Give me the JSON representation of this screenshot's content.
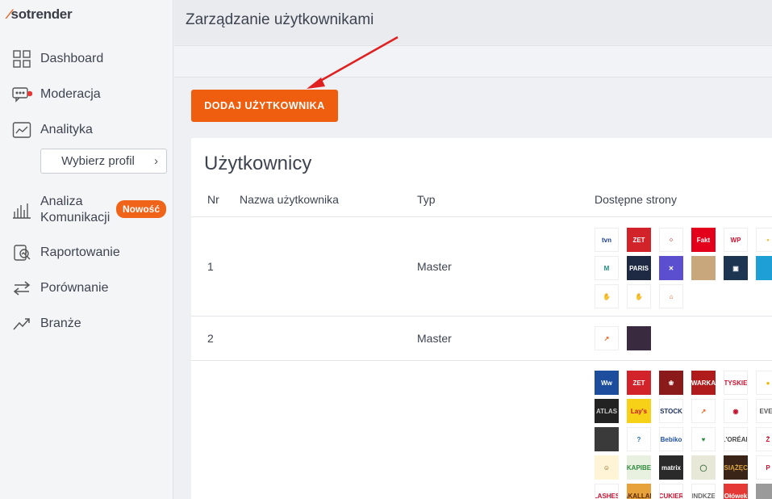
{
  "app": {
    "logo": "sotrender"
  },
  "sidebar": {
    "items": [
      {
        "label": "Dashboard",
        "icon": "dashboard-icon"
      },
      {
        "label": "Moderacja",
        "icon": "chat-icon"
      },
      {
        "label": "Analityka",
        "icon": "analytics-icon"
      },
      {
        "label": "Analiza Komunikacji",
        "icon": "bar-chart-icon"
      },
      {
        "label": "Raportowanie",
        "icon": "report-icon"
      },
      {
        "label": "Porównanie",
        "icon": "compare-icon"
      },
      {
        "label": "Branże",
        "icon": "trend-icon"
      }
    ],
    "profile_select": "Wybierz profil",
    "analysis_line1": "Analiza",
    "analysis_line2": "Komunikacji",
    "badge_new": "Nowość",
    "moderation_dot_color": "#e53935"
  },
  "header": {
    "title": "Zarządzanie użytkownikami"
  },
  "actions": {
    "add_user": "DODAJ UŻYTKOWNIKA"
  },
  "users": {
    "title": "Użytkownicy",
    "columns": [
      "Nr",
      "Nazwa użytkownika",
      "Typ",
      "Dostępne strony"
    ],
    "rows": [
      {
        "nr": "1",
        "name": "",
        "type": "Master",
        "pages_count": 15
      },
      {
        "nr": "2",
        "name": "",
        "type": "Master",
        "pages_count": 2
      },
      {
        "nr": "",
        "name": "",
        "type": "",
        "pages_count": 35
      }
    ]
  },
  "page_thumbs": {
    "row1": [
      {
        "label": "tvn",
        "bg": "#ffffff",
        "fg": "#1a3d8f"
      },
      {
        "label": "ZET",
        "bg": "#d2232a",
        "fg": "#ffffff"
      },
      {
        "label": "⁘",
        "bg": "#ffffff",
        "fg": "#e53935"
      },
      {
        "label": "Fakt",
        "bg": "#e3001b",
        "fg": "#ffffff"
      },
      {
        "label": "WP",
        "bg": "#ffffff",
        "fg": "#c8102e"
      },
      {
        "label": "•",
        "bg": "#ffffff",
        "fg": "#f5b800"
      },
      {
        "label": "M",
        "bg": "#ffffff",
        "fg": "#1a8f7a"
      },
      {
        "label": "PARIS",
        "bg": "#1e2a44",
        "fg": "#ffffff"
      },
      {
        "label": "✕",
        "bg": "#5b4fcf",
        "fg": "#ffffff"
      },
      {
        "label": "",
        "bg": "#c9a77c",
        "fg": "#ffffff"
      },
      {
        "label": "▣",
        "bg": "#1e3552",
        "fg": "#ffffff"
      },
      {
        "label": "",
        "bg": "#1ea0d6",
        "fg": "#ffffff"
      },
      {
        "label": "✋",
        "bg": "#ffffff",
        "fg": "#e53935"
      },
      {
        "label": "✋",
        "bg": "#ffffff",
        "fg": "#222222"
      },
      {
        "label": "⌂",
        "bg": "#ffffff",
        "fg": "#e8601c"
      }
    ],
    "row2": [
      {
        "label": "↗",
        "bg": "#ffffff",
        "fg": "#e8601c"
      },
      {
        "label": "",
        "bg": "#3a2a40",
        "fg": "#ffffff"
      }
    ],
    "row3": [
      {
        "label": "Ww",
        "bg": "#1d4e9e",
        "fg": "#ffffff"
      },
      {
        "label": "ZET",
        "bg": "#d2232a",
        "fg": "#ffffff"
      },
      {
        "label": "❀",
        "bg": "#8b1a1a",
        "fg": "#ffffff"
      },
      {
        "label": "WARKA",
        "bg": "#b01c1c",
        "fg": "#ffffff"
      },
      {
        "label": "TYSKIE",
        "bg": "#ffffff",
        "fg": "#c8102e"
      },
      {
        "label": "●",
        "bg": "#ffffff",
        "fg": "#f5b800"
      },
      {
        "label": "ATLAS",
        "bg": "#222222",
        "fg": "#cccccc"
      },
      {
        "label": "Lay's",
        "bg": "#f7d117",
        "fg": "#c8102e"
      },
      {
        "label": "STOCK",
        "bg": "#ffffff",
        "fg": "#1d2f5e"
      },
      {
        "label": "↗",
        "bg": "#ffffff",
        "fg": "#e8601c"
      },
      {
        "label": "◉",
        "bg": "#ffffff",
        "fg": "#c8102e"
      },
      {
        "label": "EVEL",
        "bg": "#ffffff",
        "fg": "#555555"
      },
      {
        "label": "",
        "bg": "#3a3a3a",
        "fg": "#ffffff"
      },
      {
        "label": "?",
        "bg": "#ffffff",
        "fg": "#1d6fb8"
      },
      {
        "label": "Bebiko",
        "bg": "#ffffff",
        "fg": "#1d4e9e"
      },
      {
        "label": "♥",
        "bg": "#ffffff",
        "fg": "#2e8b3e"
      },
      {
        "label": "L'ORÉAL",
        "bg": "#ffffff",
        "fg": "#444444"
      },
      {
        "label": "Ż",
        "bg": "#ffffff",
        "fg": "#c8102e"
      },
      {
        "label": "☺",
        "bg": "#fff4d6",
        "fg": "#6b4a00"
      },
      {
        "label": "KAPIBE",
        "bg": "#e8f1e0",
        "fg": "#2e8b3e"
      },
      {
        "label": "matrix",
        "bg": "#2a2a2a",
        "fg": "#ffffff"
      },
      {
        "label": "◯",
        "bg": "#e8e8d8",
        "fg": "#3a6b3a"
      },
      {
        "label": "KSIĄŻĘCE",
        "bg": "#3a2418",
        "fg": "#d9a441"
      },
      {
        "label": "P",
        "bg": "#ffffff",
        "fg": "#c8102e"
      },
      {
        "label": "LASHES",
        "bg": "#ffffff",
        "fg": "#c8102e"
      },
      {
        "label": "BAKALLAND",
        "bg": "#e8a23c",
        "fg": "#5a2a00"
      },
      {
        "label": "CUKIER",
        "bg": "#ffffff",
        "fg": "#c8102e"
      },
      {
        "label": "INDKZE",
        "bg": "#ffffff",
        "fg": "#666666"
      },
      {
        "label": "Ołówek",
        "bg": "#e53935",
        "fg": "#ffffff"
      },
      {
        "label": "",
        "bg": "#9a9a9a",
        "fg": "#ffffff"
      }
    ]
  }
}
